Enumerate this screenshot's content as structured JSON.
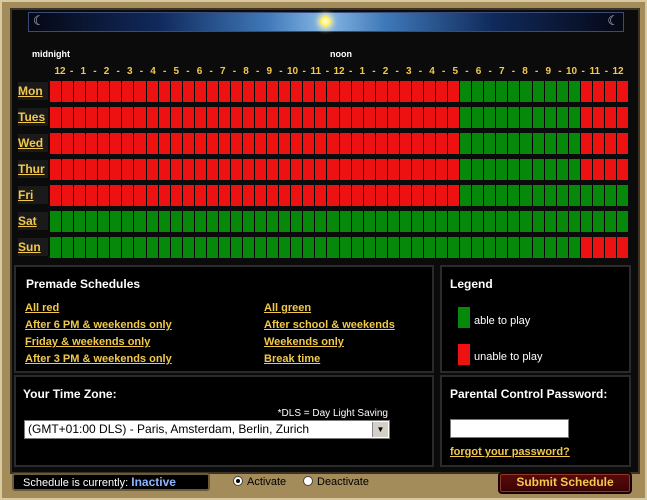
{
  "timeline": {
    "midnight_label": "midnight",
    "noon_label": "noon",
    "hour_labels": [
      "12",
      "1",
      "2",
      "3",
      "4",
      "5",
      "6",
      "7",
      "8",
      "9",
      "10",
      "11",
      "12",
      "1",
      "2",
      "3",
      "4",
      "5",
      "6",
      "7",
      "8",
      "9",
      "10",
      "11",
      "12"
    ]
  },
  "schedule": {
    "slots_per_day": 48,
    "days": [
      {
        "label": "Mon",
        "red_before": 34,
        "red_after": 44
      },
      {
        "label": "Tues",
        "red_before": 34,
        "red_after": 44
      },
      {
        "label": "Wed",
        "red_before": 34,
        "red_after": 44
      },
      {
        "label": "Thur",
        "red_before": 34,
        "red_after": 44
      },
      {
        "label": "Fri",
        "red_before": 34,
        "red_after": 48
      },
      {
        "label": "Sat",
        "red_before": 0,
        "red_after": 48
      },
      {
        "label": "Sun",
        "red_before": 0,
        "red_after": 44
      }
    ]
  },
  "premade": {
    "title": "Premade Schedules",
    "links": [
      "All red",
      "After 6 PM & weekends only",
      "Friday & weekends only",
      "After 3 PM & weekends only",
      "All green",
      "After school & weekends",
      "Weekends only",
      "Break time"
    ]
  },
  "legend": {
    "title": "Legend",
    "able": "able to play",
    "unable": "unable to play",
    "able_color": "#06880a",
    "unable_color": "#ee1111"
  },
  "timezone": {
    "title": "Your Time Zone:",
    "note": "*DLS = Day Light Saving",
    "selected": "(GMT+01:00 DLS) - Paris, Amsterdam, Berlin, Zurich"
  },
  "password": {
    "title": "Parental Control Password:",
    "value": "",
    "forgot": "forgot your password?"
  },
  "status": {
    "prefix": "Schedule is currently:",
    "value": "Inactive",
    "activate": "Activate",
    "deactivate": "Deactivate",
    "selected": "Activate"
  },
  "submit_label": "Submit Schedule"
}
